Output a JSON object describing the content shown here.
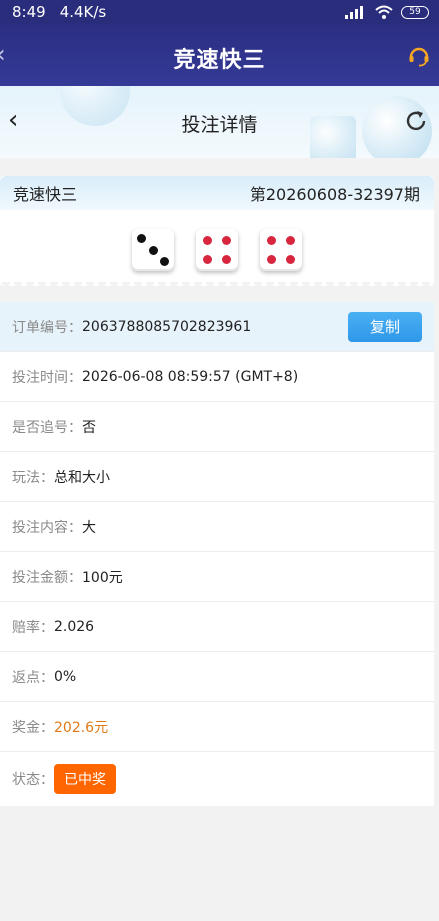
{
  "status_bar": {
    "time": "8:49",
    "speed": "4.4K/s",
    "battery": "59"
  },
  "app_bar": {
    "title": "竞速快三"
  },
  "detail_header": {
    "title": "投注详情"
  },
  "draw": {
    "game": "竞速快三",
    "issue": "第20260608-32397期",
    "dice": [
      3,
      4,
      4
    ]
  },
  "order": {
    "order_no_label": "订单编号：",
    "order_no": "2063788085702823961",
    "copy_label": "复制",
    "rows": [
      {
        "label": "投注时间：",
        "value": "2026-06-08 08:59:57 (GMT+8)"
      },
      {
        "label": "是否追号：",
        "value": "否"
      },
      {
        "label": "玩法：",
        "value": "总和大小"
      },
      {
        "label": "投注内容：",
        "value": "大"
      },
      {
        "label": "投注金额：",
        "value": "100元"
      },
      {
        "label": "赔率：",
        "value": "2.026"
      },
      {
        "label": "返点：",
        "value": "0%"
      },
      {
        "label": "奖金：",
        "value": "202.6元"
      }
    ],
    "status_label": "状态：",
    "status_value": "已中奖"
  },
  "colors": {
    "header_bg": "#2b2e82",
    "accent_blue": "#2e97e8",
    "prize_orange": "#e07a18",
    "status_badge": "#ff6600"
  }
}
